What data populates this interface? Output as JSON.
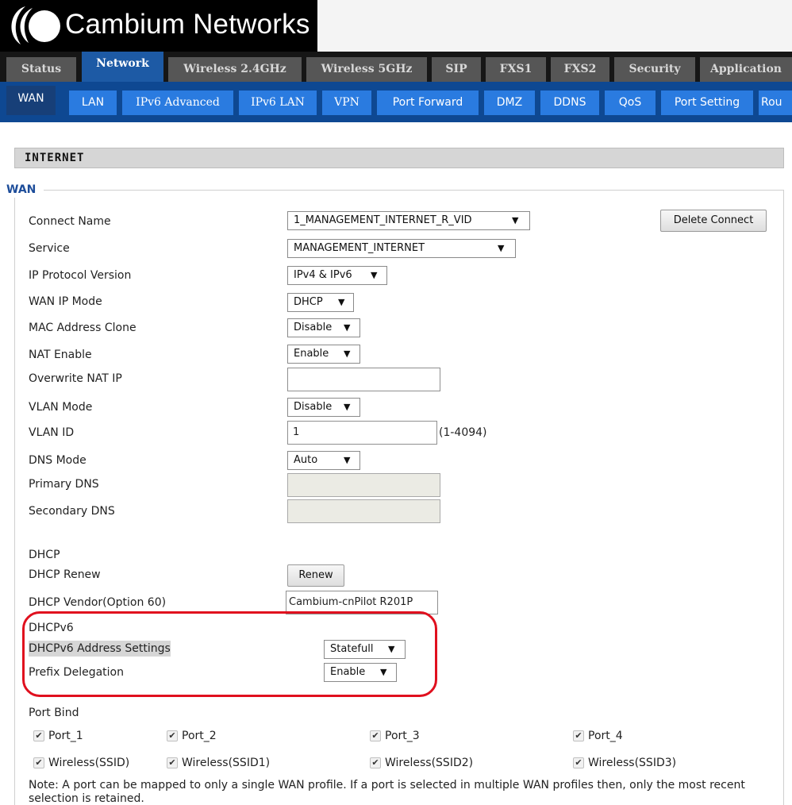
{
  "brand": {
    "name": "Cambium Networks"
  },
  "main_tabs": [
    "Status",
    "Network",
    "Wireless 2.4GHz",
    "Wireless 5GHz",
    "SIP",
    "FXS1",
    "FXS2",
    "Security",
    "Application"
  ],
  "sub_tabs": [
    "WAN",
    "LAN",
    "IPv6 Advanced",
    "IPv6 LAN",
    "VPN",
    "Port Forward",
    "DMZ",
    "DDNS",
    "QoS",
    "Port Setting",
    "Rou"
  ],
  "section_title": "INTERNET",
  "wan": {
    "legend": "WAN",
    "connect_name": {
      "label": "Connect Name",
      "value": "1_MANAGEMENT_INTERNET_R_VID"
    },
    "delete_button": "Delete Connect",
    "service": {
      "label": "Service",
      "value": "MANAGEMENT_INTERNET"
    },
    "ip_protocol": {
      "label": "IP Protocol Version",
      "value": "IPv4 & IPv6"
    },
    "wan_ip_mode": {
      "label": "WAN IP Mode",
      "value": "DHCP"
    },
    "mac_clone": {
      "label": "MAC Address Clone",
      "value": "Disable"
    },
    "nat_enable": {
      "label": "NAT Enable",
      "value": "Enable"
    },
    "overwrite_nat_ip": {
      "label": "Overwrite NAT IP",
      "value": ""
    },
    "vlan_mode": {
      "label": "VLAN Mode",
      "value": "Disable"
    },
    "vlan_id": {
      "label": "VLAN ID",
      "value": "1",
      "hint": "(1-4094)"
    },
    "dns_mode": {
      "label": "DNS Mode",
      "value": "Auto"
    },
    "primary_dns": {
      "label": "Primary DNS",
      "value": ""
    },
    "secondary_dns": {
      "label": "Secondary DNS",
      "value": ""
    }
  },
  "dhcp": {
    "heading": "DHCP",
    "renew": {
      "label": "DHCP Renew",
      "button": "Renew"
    },
    "vendor": {
      "label": "DHCP Vendor(Option 60)",
      "value": "Cambium-cnPilot R201P"
    }
  },
  "dhcpv6": {
    "heading": "DHCPv6",
    "address_settings": {
      "label": "DHCPv6 Address Settings",
      "value": "Statefull"
    },
    "prefix_delegation": {
      "label": "Prefix Delegation",
      "value": "Enable"
    }
  },
  "port_bind": {
    "heading": "Port Bind",
    "ports": [
      "Port_1",
      "Port_2",
      "Port_3",
      "Port_4"
    ],
    "wireless": [
      "Wireless(SSID)",
      "Wireless(SSID1)",
      "Wireless(SSID2)",
      "Wireless(SSID3)"
    ],
    "note": "Note: A port can be mapped to only a single WAN profile. If a port is selected in multiple WAN profiles then, only the most recent selection is retained."
  },
  "colors": {
    "accent": "#1d5aa5",
    "subbar": "#0e4892",
    "highlight": "#e0101e"
  },
  "icons": {
    "dropdown": "▼",
    "checkbox_checked": "✔"
  }
}
